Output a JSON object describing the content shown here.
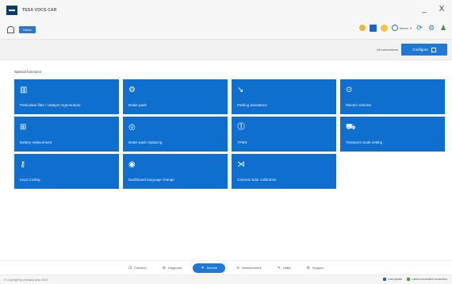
{
  "app": {
    "title": "TESA VOCS CAR"
  },
  "window": {
    "minimize": "_",
    "close": "X"
  },
  "toolbar": {
    "breadcrumb": "Home",
    "user_label": "Admin",
    "user_caret": "▾",
    "icons": [
      "warning-icon",
      "save-icon",
      "sun-icon",
      "user-globe-icon",
      "refresh-icon",
      "settings-icon",
      "account-icon"
    ]
  },
  "actionbar": {
    "all_connections": "All connections",
    "configure": "Configure"
  },
  "section": {
    "title": "Special functions"
  },
  "tiles": [
    {
      "label": "Particulate filter / catalyst regeneration",
      "icon": "▥"
    },
    {
      "label": "Brake pads",
      "icon": "⚙"
    },
    {
      "label": "Parking assistance",
      "icon": "↘"
    },
    {
      "label": "Electric vehicles",
      "icon": "⊙"
    },
    {
      "label": "Battery replacement",
      "icon": "⊞"
    },
    {
      "label": "Brake pads replacing",
      "icon": "◎"
    },
    {
      "label": "TPMS",
      "icon": "⓵"
    },
    {
      "label": "Transport mode setting",
      "icon": "⛟"
    },
    {
      "label": "Keys Coding",
      "icon": "⚷"
    },
    {
      "label": "Dashboard language change",
      "icon": "◉"
    },
    {
      "label": "Camera radar calibration",
      "icon": "⋊"
    }
  ],
  "bottom_nav": [
    {
      "label": "Function",
      "icon": "⊡",
      "active": false
    },
    {
      "label": "Diagnosis",
      "icon": "⊛",
      "active": false
    },
    {
      "label": "Service",
      "icon": "✦",
      "active": true
    },
    {
      "label": "Measurement",
      "icon": "≋",
      "active": false
    },
    {
      "label": "Utility",
      "icon": "✎",
      "active": false
    },
    {
      "label": "Support",
      "icon": "⊕",
      "active": false
    }
  ],
  "status": {
    "left": "© Copyright by company year 2023",
    "right1": "Last update",
    "right2": "Latest successful connection"
  },
  "colors": {
    "tile": "#0f6fcf",
    "accent": "#1f79d4",
    "logo": "#0b3b6b"
  }
}
